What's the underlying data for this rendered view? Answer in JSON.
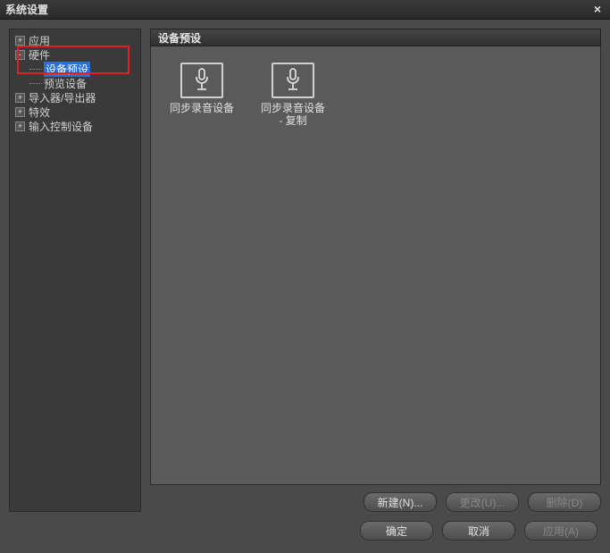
{
  "window": {
    "title": "系统设置"
  },
  "sidebar": {
    "items": [
      {
        "label": "应用",
        "toggle": "+"
      },
      {
        "label": "硬件",
        "toggle": "-"
      },
      {
        "label": "设备预设"
      },
      {
        "label": "预览设备"
      },
      {
        "label": "导入器/导出器",
        "toggle": "+"
      },
      {
        "label": "特效",
        "toggle": "+"
      },
      {
        "label": "输入控制设备",
        "toggle": "+"
      }
    ]
  },
  "main": {
    "header": "设备预设",
    "devices": [
      {
        "label": "同步录音设备"
      },
      {
        "label": "同步录音设备 - 复制"
      }
    ],
    "buttons": {
      "new": "新建(N)...",
      "change": "更改(U)...",
      "delete": "删除(D)"
    }
  },
  "footer": {
    "ok": "确定",
    "cancel": "取消",
    "apply": "应用(A)"
  }
}
